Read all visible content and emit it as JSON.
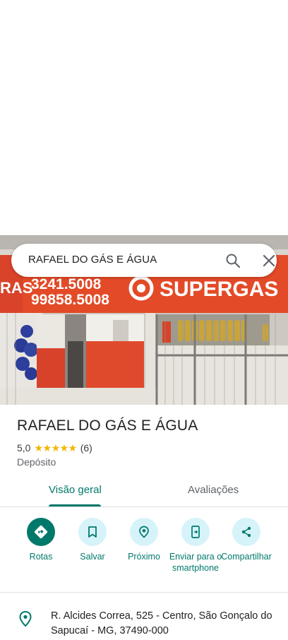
{
  "search": {
    "query": "RAFAEL DO GÁS E ÁGUA"
  },
  "photo": {
    "sign_text_left": "RAS",
    "sign_phone_1": "3241.5008",
    "sign_phone_2": "99858.5008",
    "sign_brand": "SUPERGAS"
  },
  "place": {
    "title": "RAFAEL DO GÁS E ÁGUA",
    "rating": "5,0",
    "stars": "★★★★★",
    "review_count": "(6)",
    "category": "Depósito"
  },
  "tabs": [
    {
      "label": "Visão geral",
      "selected": true
    },
    {
      "label": "Avaliações",
      "selected": false
    }
  ],
  "actions": [
    {
      "label": "Rotas",
      "icon": "directions-icon"
    },
    {
      "label": "Salvar",
      "icon": "bookmark-icon"
    },
    {
      "label": "Próximo",
      "icon": "nearby-icon"
    },
    {
      "label": "Enviar para o smartphone",
      "icon": "send-to-phone-icon"
    },
    {
      "label": "Compartilhar",
      "icon": "share-icon"
    }
  ],
  "address": {
    "text": "R. Alcides Correa, 525 - Centro, São Gonçalo do Sapucaí - MG, 37490-000",
    "icon": "location-pin-icon"
  },
  "colors": {
    "accent": "#00796b",
    "action_bg": "#d6f3fa",
    "star": "#f5b400",
    "sign": "#e34a27"
  }
}
